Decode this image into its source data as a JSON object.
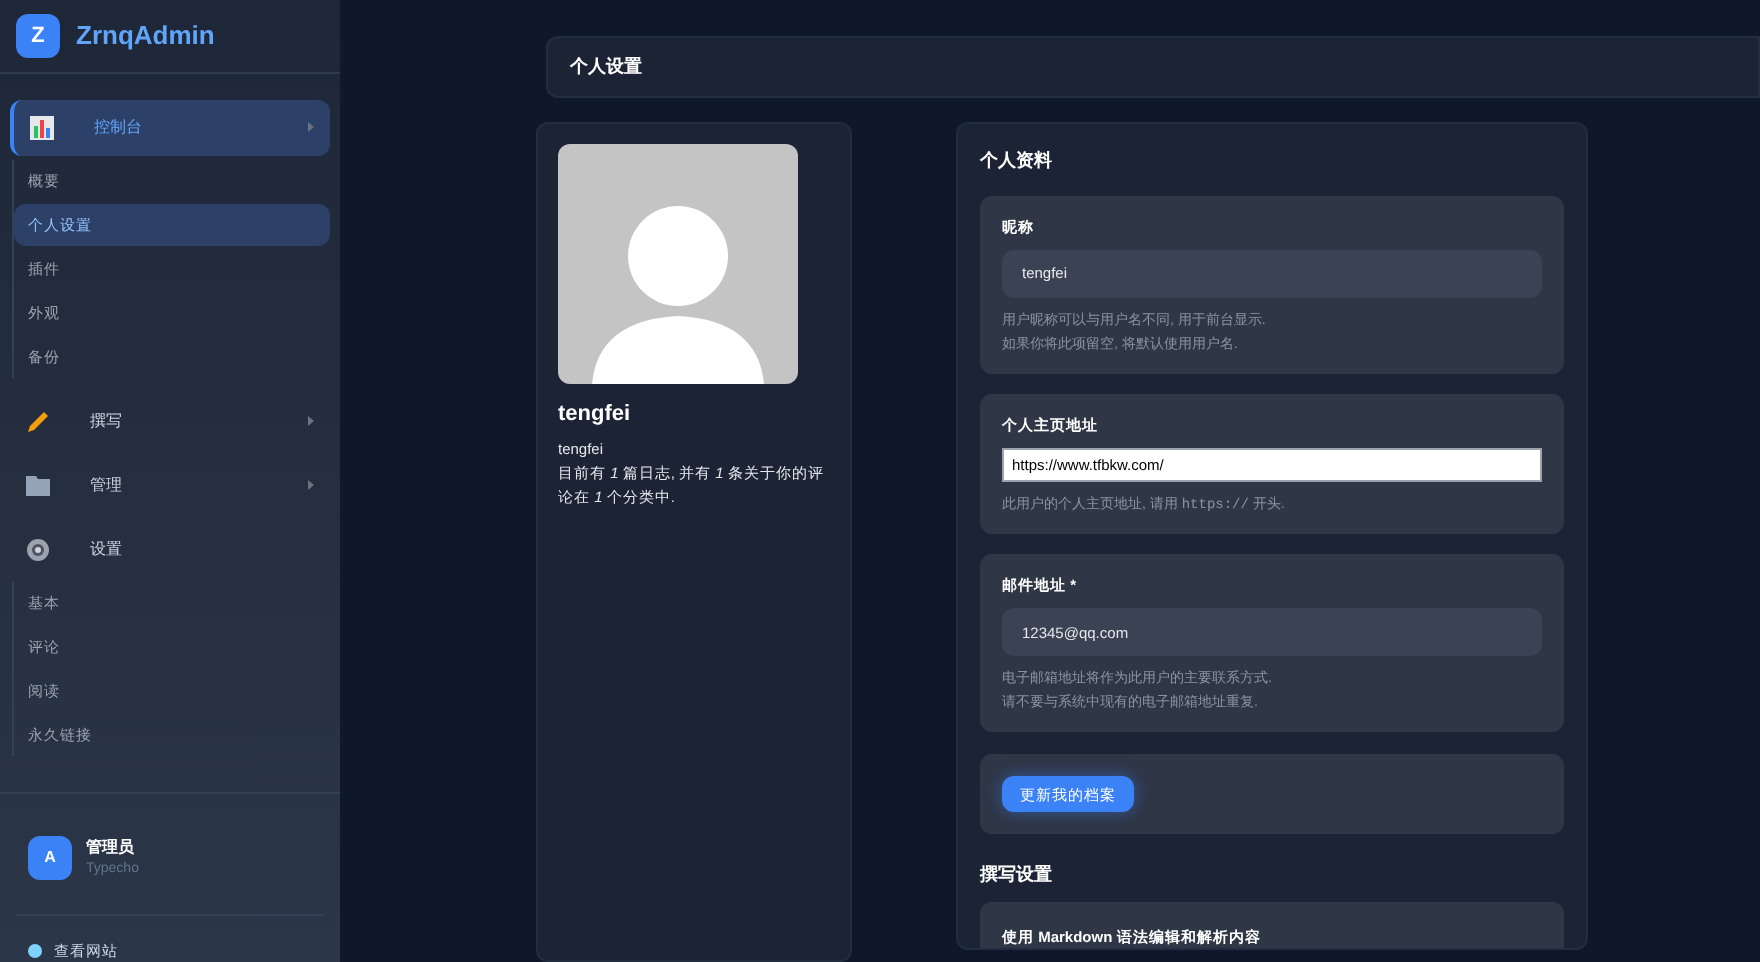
{
  "brand": {
    "logo_letter": "Z",
    "name": "ZrnqAdmin"
  },
  "sidebar": {
    "sections": [
      {
        "kind": "chart",
        "label": "控制台",
        "active": true,
        "chevron": true,
        "children": [
          {
            "label": "概要",
            "selected": false
          },
          {
            "label": "个人设置",
            "selected": true
          },
          {
            "label": "插件",
            "selected": false
          },
          {
            "label": "外观",
            "selected": false
          },
          {
            "label": "备份",
            "selected": false
          }
        ]
      },
      {
        "kind": "pencil",
        "label": "撰写",
        "active": false,
        "chevron": true
      },
      {
        "kind": "folder",
        "label": "管理",
        "active": false,
        "chevron": true
      },
      {
        "kind": "gear",
        "label": "设置",
        "active": false,
        "chevron": false,
        "children": [
          {
            "label": "基本",
            "selected": false
          },
          {
            "label": "评论",
            "selected": false
          },
          {
            "label": "阅读",
            "selected": false
          },
          {
            "label": "永久链接",
            "selected": false
          }
        ]
      }
    ],
    "user": {
      "avatar_letter": "A",
      "name": "管理员",
      "role": "Typecho"
    },
    "links": [
      {
        "label": "查看网站"
      }
    ]
  },
  "page_title": "个人设置",
  "profile": {
    "display_name": "tengfei",
    "username": "tengfei",
    "stats": "目前有 *1* 篇日志, 并有 *1* 条关于你的评论在 *1* 个分类中."
  },
  "profile_form": {
    "title": "个人资料",
    "fields": [
      {
        "label": "昵称",
        "value": "tengfei",
        "focused": false,
        "help": [
          [
            {
              "text": "用户昵称可以与用户名不同, 用于前台显示.",
              "code": false
            }
          ],
          [
            {
              "text": "如果你将此项留空, 将默认使用用户名.",
              "code": false
            }
          ]
        ]
      },
      {
        "label": "个人主页地址",
        "value": "https://www.tfbkw.com/",
        "focused": true,
        "help": [
          [
            {
              "text": "此用户的个人主页地址, 请用 ",
              "code": false
            },
            {
              "text": "https://",
              "code": true
            },
            {
              "text": " 开头.",
              "code": false
            }
          ]
        ]
      },
      {
        "label": "邮件地址 *",
        "value": "12345@qq.com",
        "focused": false,
        "help": [
          [
            {
              "text": "电子邮箱地址将作为此用户的主要联系方式.",
              "code": false
            }
          ],
          [
            {
              "text": "请不要与系统中现有的电子邮箱地址重复.",
              "code": false
            }
          ]
        ]
      }
    ],
    "submit": "更新我的档案"
  },
  "writing": {
    "title": "撰写设置",
    "first_option": "使用 Markdown 语法编辑和解析内容"
  }
}
